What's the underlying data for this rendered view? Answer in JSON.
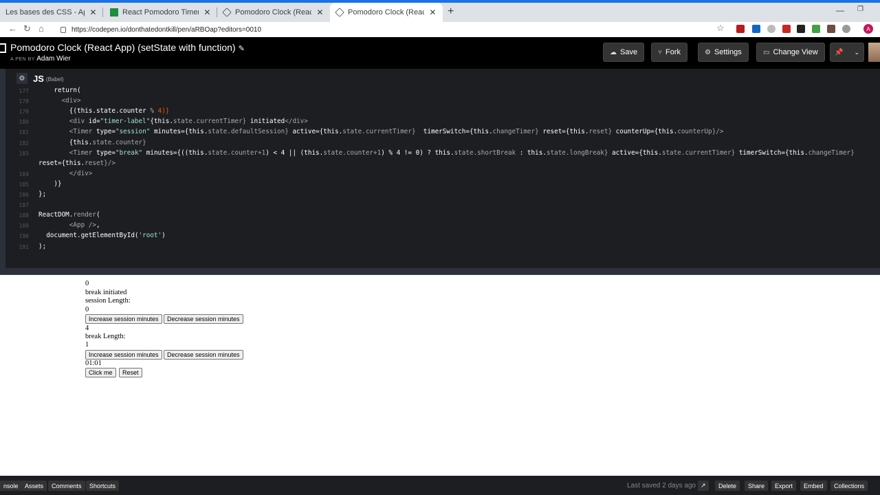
{
  "browser": {
    "tabs": [
      {
        "title": "Les bases des CSS - Apprendre le"
      },
      {
        "title": "React Pomodoro Timer Feedback"
      },
      {
        "title": "Pomodoro Clock (React App) (set"
      },
      {
        "title": "Pomodoro Clock (React App) (set"
      }
    ],
    "close_glyph": "✕",
    "new_tab_glyph": "+",
    "url": "https://codepen.io/donthatedontkill/pen/aRBOap?editors=0010",
    "window_controls": {
      "minimize": "—",
      "maximize": "❐",
      "close": "✕"
    }
  },
  "codepen": {
    "title": "Pomodoro Clock (React App) (setState with function)",
    "by_label": "A PEN BY",
    "author": "Adam Wier",
    "buttons": {
      "save": "Save",
      "fork": "Fork",
      "settings": "Settings",
      "change_view": "Change View"
    },
    "editor_lang": "JS",
    "editor_lang_sub": "(Babel)"
  },
  "code_lines": [
    {
      "n": "177",
      "segments": [
        [
          "    return(",
          "kw"
        ]
      ]
    },
    {
      "n": "178",
      "segments": [
        [
          "      <div>",
          "tag"
        ]
      ]
    },
    {
      "n": "179",
      "segments": [
        [
          "        {(this.state.counter ",
          "kw"
        ],
        [
          "%",
          "prop"
        ],
        [
          " 4)}",
          "num"
        ]
      ]
    },
    {
      "n": "180",
      "segments": [
        [
          "        <div ",
          "tag"
        ],
        [
          "id=",
          "kw"
        ],
        [
          "\"timer-label\"",
          "str"
        ],
        [
          "{this.",
          "kw"
        ],
        [
          "state.",
          "prop"
        ],
        [
          "currentTimer}",
          "prop"
        ],
        [
          " initiated",
          "kw"
        ],
        [
          "</div>",
          "tag"
        ]
      ]
    },
    {
      "n": "181",
      "segments": [
        [
          "        <Timer ",
          "tag"
        ],
        [
          "type=",
          "kw"
        ],
        [
          "\"session\"",
          "str"
        ],
        [
          " minutes={this.",
          "kw"
        ],
        [
          "state.defaultSession}",
          "prop"
        ],
        [
          " active={this.",
          "kw"
        ],
        [
          "state.currentTimer}",
          "prop"
        ],
        [
          "  timerSwitch={this.",
          "kw"
        ],
        [
          "changeTimer}",
          "prop"
        ],
        [
          " reset={this.",
          "kw"
        ],
        [
          "reset}",
          "prop"
        ],
        [
          " counterUp={this.",
          "kw"
        ],
        [
          "counterUp}",
          "prop"
        ],
        [
          "/>",
          "tag"
        ]
      ]
    },
    {
      "n": "182",
      "segments": [
        [
          "        {this.",
          "kw"
        ],
        [
          "state.counter}",
          "prop"
        ]
      ]
    },
    {
      "n": "183",
      "segments": [
        [
          "        <Timer ",
          "tag"
        ],
        [
          "type=",
          "kw"
        ],
        [
          "\"break\"",
          "str"
        ],
        [
          " minutes={((this.",
          "kw"
        ],
        [
          "state.counter+1",
          "prop"
        ],
        [
          ") < 4 || (this.",
          "kw"
        ],
        [
          "state.counter+1",
          "prop"
        ],
        [
          ") % 4 != 0) ? this.",
          "kw"
        ],
        [
          "state.shortBreak",
          "prop"
        ],
        [
          " : this.",
          "kw"
        ],
        [
          "state.longBreak}",
          "prop"
        ],
        [
          " active={this.",
          "kw"
        ],
        [
          "state.currentTimer}",
          "prop"
        ],
        [
          " timerSwitch={this.",
          "kw"
        ],
        [
          "changeTimer}",
          "prop"
        ]
      ]
    },
    {
      "n": "",
      "segments": [
        [
          "reset={this.",
          "kw"
        ],
        [
          "reset}",
          "prop"
        ],
        [
          "/>",
          "tag"
        ]
      ]
    },
    {
      "n": "184",
      "segments": [
        [
          "        </div>",
          "tag"
        ]
      ]
    },
    {
      "n": "185",
      "segments": [
        [
          "    )}",
          "kw"
        ]
      ]
    },
    {
      "n": "186",
      "segments": [
        [
          "};",
          "kw"
        ]
      ]
    },
    {
      "n": "187",
      "segments": [
        [
          "",
          "kw"
        ]
      ]
    },
    {
      "n": "188",
      "segments": [
        [
          "ReactDOM.",
          "kw"
        ],
        [
          "render",
          "prop"
        ],
        [
          "(",
          "kw"
        ]
      ]
    },
    {
      "n": "189",
      "segments": [
        [
          "        <App />",
          "tag"
        ],
        [
          ",",
          "kw"
        ]
      ]
    },
    {
      "n": "190",
      "segments": [
        [
          "  document.getElementById(",
          "kw"
        ],
        [
          "'root'",
          "str"
        ],
        [
          ")",
          "kw"
        ]
      ]
    },
    {
      "n": "191",
      "segments": [
        [
          ");",
          "kw"
        ]
      ]
    }
  ],
  "result": {
    "counter": "0",
    "timer_label": "break initiated",
    "session_label": "session Length:",
    "session_value": "0",
    "inc_session": "Increase session minutes",
    "dec_session": "Decrease session minutes",
    "counter2": "4",
    "break_label": "break Length:",
    "break_value": "1",
    "inc_break": "Increase session minutes",
    "dec_break": "Decrease session minutes",
    "time": "01:01",
    "click_me": "Click me",
    "reset": "Reset"
  },
  "footer": {
    "console": "nsole",
    "assets": "Assets",
    "comments": "Comments",
    "shortcuts": "Shortcuts",
    "last_saved": "Last saved 2 days ago",
    "delete": "Delete",
    "share": "Share",
    "export": "Export",
    "embed": "Embed",
    "collections": "Collections"
  },
  "colors": {
    "accent": "#1a73e8",
    "codepen_bg": "#000000",
    "editor_bg": "#1d1e22"
  }
}
